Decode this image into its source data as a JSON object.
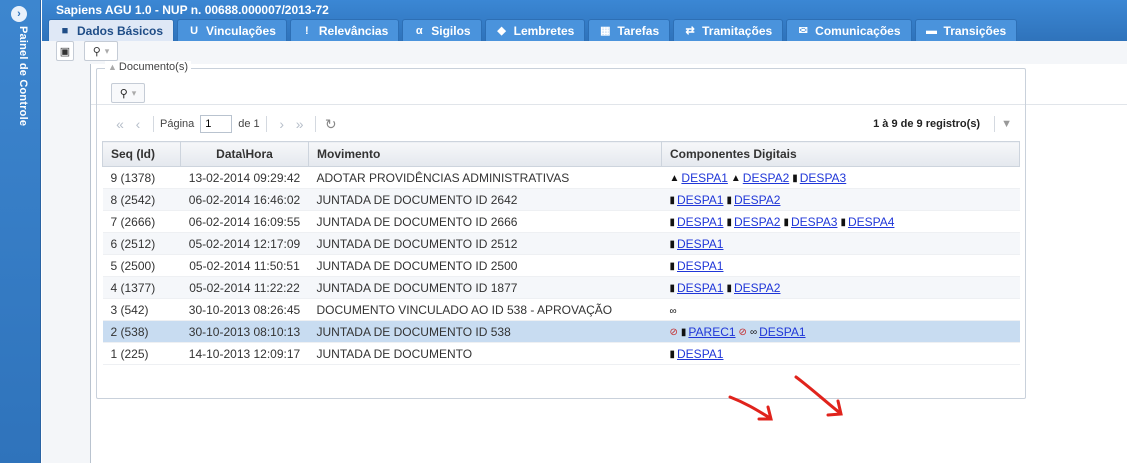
{
  "side_panel": {
    "toggle_icon": "chevron-right-circle-icon",
    "title": "Painel de Controle"
  },
  "app": {
    "title": "Sapiens AGU 1.0 - NUP n. 00688.000007/2013-72"
  },
  "tabs": [
    {
      "label": "Dados Básicos",
      "icon": "book-icon",
      "glyph": "■",
      "active": true
    },
    {
      "label": "Vinculações",
      "icon": "link-icon",
      "glyph": "U",
      "active": false
    },
    {
      "label": "Relevâncias",
      "icon": "exclamation-icon",
      "glyph": "!",
      "active": false
    },
    {
      "label": "Sigilos",
      "icon": "key-icon",
      "glyph": "α",
      "active": false
    },
    {
      "label": "Lembretes",
      "icon": "tag-icon",
      "glyph": "◆",
      "active": false
    },
    {
      "label": "Tarefas",
      "icon": "calendar-icon",
      "glyph": "▦",
      "active": false
    },
    {
      "label": "Tramitações",
      "icon": "transfer-icon",
      "glyph": "⇄",
      "active": false
    },
    {
      "label": "Comunicações",
      "icon": "envelope-icon",
      "glyph": "✉",
      "active": false
    },
    {
      "label": "Transições",
      "icon": "archive-icon",
      "glyph": "▬",
      "active": false
    }
  ],
  "toolbar": {
    "save_icon": "save-icon",
    "tools_icon": "wrench-icon"
  },
  "documents": {
    "legend": "Documento(s)",
    "pager": {
      "page_label": "Página",
      "page_value": "1",
      "of_label": "de 1",
      "info": "1 à 9 de 9 registro(s)"
    },
    "columns": [
      "Seq (Id)",
      "Data\\Hora",
      "Movimento",
      "Componentes Digitais"
    ],
    "rows": [
      {
        "seq": "9 (1378)",
        "datetime": "13-02-2014 09:29:42",
        "movement": "ADOTAR PROVIDÊNCIAS ADMINISTRATIVAS",
        "components": [
          {
            "icon": "lock-icon",
            "label": "DESPA1"
          },
          {
            "icon": "lock-icon",
            "label": "DESPA2"
          },
          {
            "icon": "document-icon",
            "label": "DESPA3"
          }
        ]
      },
      {
        "seq": "8 (2542)",
        "datetime": "06-02-2014 16:46:02",
        "movement": "JUNTADA DE DOCUMENTO ID 2642",
        "components": [
          {
            "icon": "document-icon",
            "label": "DESPA1"
          },
          {
            "icon": "document-icon",
            "label": "DESPA2"
          }
        ]
      },
      {
        "seq": "7 (2666)",
        "datetime": "06-02-2014 16:09:55",
        "movement": "JUNTADA DE DOCUMENTO ID 2666",
        "components": [
          {
            "icon": "document-icon",
            "label": "DESPA1"
          },
          {
            "icon": "document-icon",
            "label": "DESPA2"
          },
          {
            "icon": "document-icon",
            "label": "DESPA3"
          },
          {
            "icon": "document-icon",
            "label": "DESPA4"
          }
        ]
      },
      {
        "seq": "6 (2512)",
        "datetime": "05-02-2014 12:17:09",
        "movement": "JUNTADA DE DOCUMENTO ID 2512",
        "components": [
          {
            "icon": "document-icon",
            "label": "DESPA1"
          }
        ]
      },
      {
        "seq": "5 (2500)",
        "datetime": "05-02-2014 11:50:51",
        "movement": "JUNTADA DE DOCUMENTO ID 2500",
        "components": [
          {
            "icon": "document-icon",
            "label": "DESPA1"
          }
        ]
      },
      {
        "seq": "4 (1377)",
        "datetime": "05-02-2014 11:22:22",
        "movement": "JUNTADA DE DOCUMENTO ID 1877",
        "components": [
          {
            "icon": "document-icon",
            "label": "DESPA1"
          },
          {
            "icon": "document-icon",
            "label": "DESPA2"
          }
        ]
      },
      {
        "seq": "3 (542)",
        "datetime": "30-10-2013 08:26:45",
        "movement": "DOCUMENTO VINCULADO AO ID 538 - APROVAÇÃO",
        "components": [
          {
            "icon": "chain-link-icon",
            "label": ""
          }
        ]
      },
      {
        "seq": "2 (538)",
        "datetime": "30-10-2013 08:10:13",
        "movement": "JUNTADA DE DOCUMENTO ID 538",
        "selected": true,
        "components": [
          {
            "icon": "restricted-eye-icon",
            "label": ""
          },
          {
            "icon": "document-icon",
            "label": "PAREC1"
          },
          {
            "icon": "restricted-eye-icon",
            "label": ""
          },
          {
            "icon": "chain-link-icon",
            "label": "DESPA1"
          }
        ]
      },
      {
        "seq": "1 (225)",
        "datetime": "14-10-2013 12:09:17",
        "movement": "JUNTADA DE DOCUMENTO",
        "components": [
          {
            "icon": "document-icon",
            "label": "DESPA1"
          }
        ]
      }
    ]
  },
  "annotation_arrows": {
    "color": "#e0231c"
  }
}
